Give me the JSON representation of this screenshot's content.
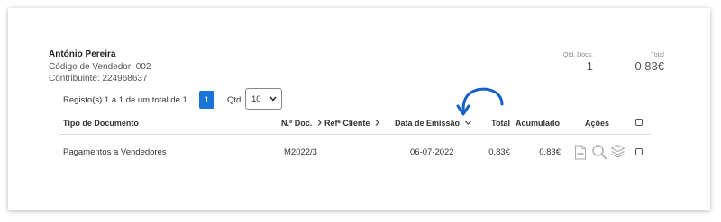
{
  "seller": {
    "name": "António Pereira",
    "code_line": "Código de Vendedor: 002",
    "tax_line": "Contribuinte: 224968637"
  },
  "summary": {
    "docs_label": "Qtd. Docs.",
    "docs_value": "1",
    "total_label": "Total",
    "total_value": "0,83€"
  },
  "pagination": {
    "records_text": "Registo(s) 1 a 1 de um total de 1",
    "current_page": "1",
    "qty_label": "Qtd.",
    "qty_value": "10"
  },
  "table": {
    "headers": {
      "doc_type": "Tipo de Documento",
      "doc_no": "N.º Doc.",
      "client_ref": "Refª Cliente",
      "issue_date": "Data de Emissão",
      "total": "Total",
      "accumulated": "Acumulado",
      "actions": "Ações"
    },
    "rows": [
      {
        "doc_type": "Pagamentos a Vendedores",
        "doc_no": "M2022/3",
        "issue_date": "06-07-2022",
        "total": "0,83€",
        "accumulated": "0,83€"
      }
    ]
  },
  "colors": {
    "accent": "#1a73d8",
    "annotation_arrow": "#1560c8"
  },
  "icons": [
    "chevron-right-icon",
    "chevron-down-icon",
    "arrow-annotation-icon",
    "pdf-icon",
    "search-icon",
    "layers-icon"
  ]
}
